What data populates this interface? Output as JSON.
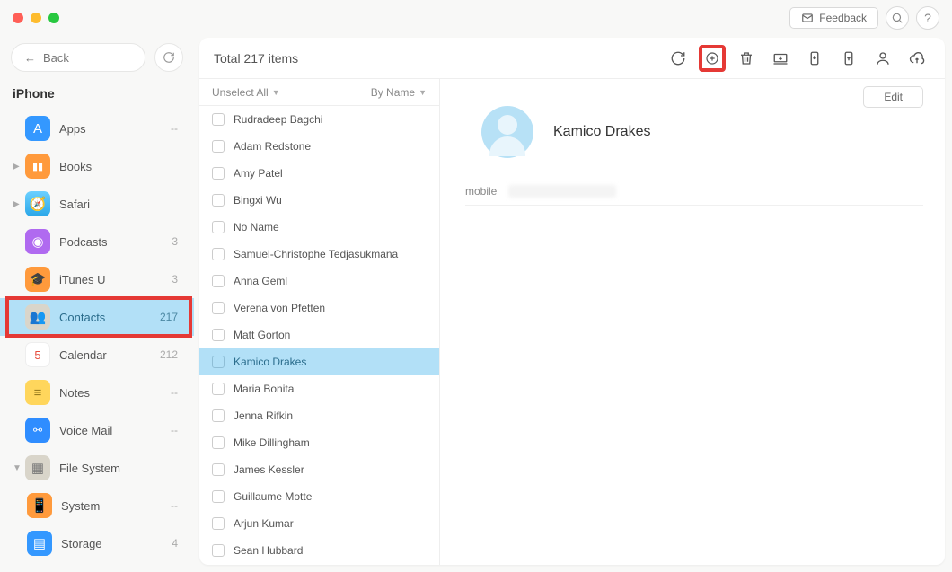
{
  "header": {
    "feedback_label": "Feedback"
  },
  "sidebar": {
    "back_label": "Back",
    "device_title": "iPhone",
    "items": [
      {
        "label": "Apps",
        "count": "--"
      },
      {
        "label": "Books",
        "count": ""
      },
      {
        "label": "Safari",
        "count": ""
      },
      {
        "label": "Podcasts",
        "count": "3"
      },
      {
        "label": "iTunes U",
        "count": "3"
      },
      {
        "label": "Contacts",
        "count": "217"
      },
      {
        "label": "Calendar",
        "count": "212"
      },
      {
        "label": "Notes",
        "count": "--"
      },
      {
        "label": "Voice Mail",
        "count": "--"
      },
      {
        "label": "File System",
        "count": ""
      },
      {
        "label": "System",
        "count": "--"
      },
      {
        "label": "Storage",
        "count": "4"
      }
    ]
  },
  "toolbar": {
    "total_label": "Total 217 items"
  },
  "list": {
    "unselect_label": "Unselect All",
    "sort_label": "By Name",
    "rows": [
      "Rudradeep Bagchi",
      "Adam Redstone",
      "Amy Patel",
      "Bingxi Wu",
      "No Name",
      "Samuel-Christophe Tedjasukmana",
      "Anna Geml",
      "Verena von Pfetten",
      "Matt Gorton",
      "Kamico Drakes",
      "Maria Bonita",
      "Jenna Rifkin",
      "Mike Dillingham",
      "James Kessler",
      "Guillaume Motte",
      "Arjun Kumar",
      "Sean Hubbard"
    ],
    "selected_index": 9
  },
  "detail": {
    "edit_label": "Edit",
    "name": "Kamico  Drakes",
    "field_label": "mobile"
  }
}
